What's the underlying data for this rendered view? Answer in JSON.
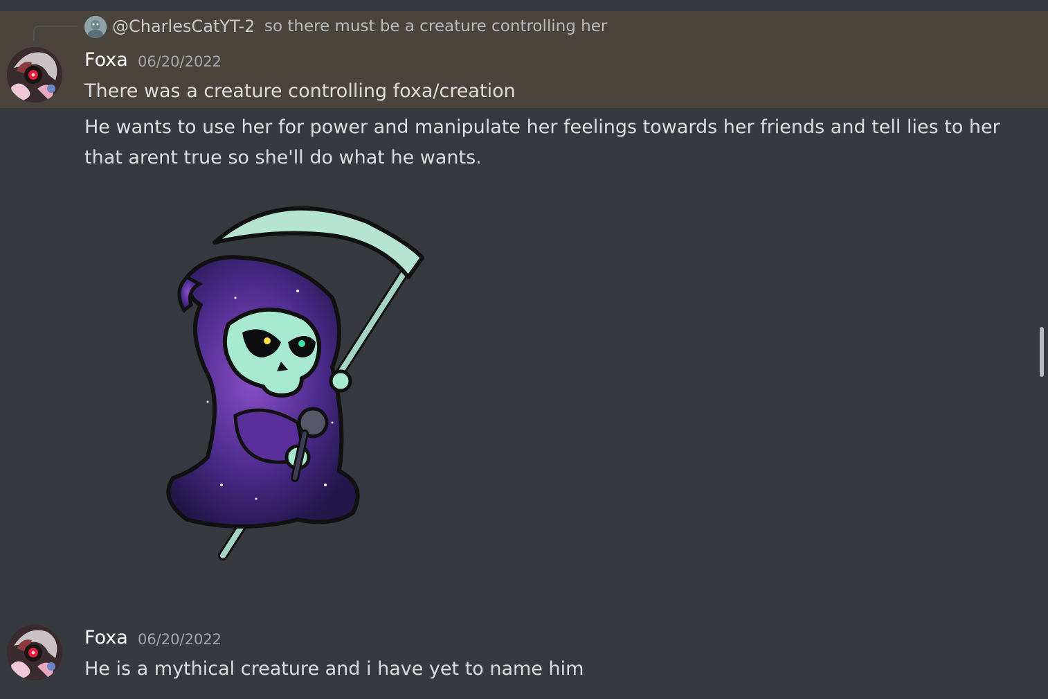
{
  "reply": {
    "author": "@CharlesCatYT-2",
    "text": "so there must be a creature controlling her",
    "avatar_icon": "user-avatar-icon"
  },
  "messages": [
    {
      "username": "Foxa",
      "timestamp": "06/20/2022",
      "lines": [
        "There was a creature controlling foxa/creation"
      ]
    },
    {
      "lines": [
        "He wants to use her for power and manipulate her feelings towards her friends and tell lies to her",
        "that arent true so she'll do what he wants."
      ],
      "sticker": "grim-reaper-sticker"
    },
    {
      "username": "Foxa",
      "timestamp": "06/20/2022",
      "lines": [
        "He is a mythical creature and i have yet to name him"
      ]
    }
  ],
  "colors": {
    "background": "#36393f",
    "highlight": "#4a443d",
    "username": "#ffffff",
    "timestamp": "#a3a6aa",
    "text": "#dcddde"
  }
}
